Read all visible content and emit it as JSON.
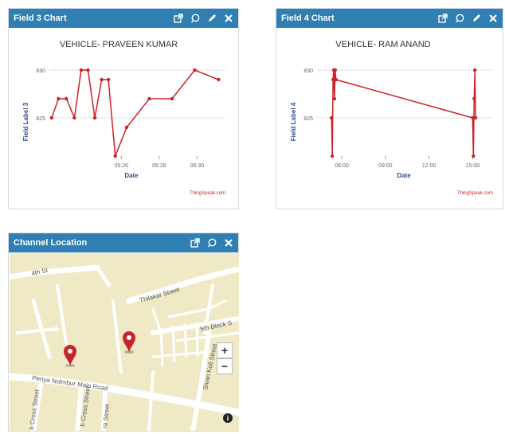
{
  "widgets": {
    "field3": {
      "title": "Field 3 Chart",
      "credit": "ThingSpeak.com"
    },
    "field4": {
      "title": "Field 4 Chart",
      "credit": "ThingSpeak.com"
    },
    "location": {
      "title": "Channel Location"
    }
  },
  "header_icons": [
    "external-link-icon",
    "comment-icon",
    "pencil-icon",
    "close-icon"
  ],
  "colors": {
    "header": "#2f7fb2",
    "series": "#cc2229",
    "axis_label": "#2c4f8a",
    "map_bg": "#efe9c5",
    "road": "#ffffff",
    "pin": "#c8242b"
  },
  "map": {
    "streets": [
      "4th St",
      "Thilakar Street",
      "5th Block S",
      "Periya Nolmbur Main Road",
      "Sivan Koil Street",
      "h Cross Street",
      "h Cross Street",
      "ra Street"
    ],
    "zoom_in": "+",
    "zoom_out": "−",
    "info": "i"
  },
  "chart_data": [
    {
      "type": "line",
      "title": "VEHICLE- PRAVEEN KUMAR",
      "xlabel": "Date",
      "ylabel": "Field Label 3",
      "ylim": [
        821,
        831
      ],
      "yticks": [
        825,
        830
      ],
      "xlim": [
        5.37,
        5.525
      ],
      "xticks": [
        {
          "v": 5.4333,
          "label": "05:26"
        },
        {
          "v": 5.4667,
          "label": "05:28"
        },
        {
          "v": 5.5,
          "label": "05:30"
        }
      ],
      "grid": true,
      "series": [
        {
          "x": [
            5.372,
            5.378,
            5.385,
            5.392,
            5.398,
            5.404,
            5.41,
            5.416,
            5.422,
            5.428,
            5.438,
            5.458,
            5.478,
            5.498,
            5.519
          ],
          "y": [
            825,
            827,
            827,
            825,
            830,
            830,
            825,
            829,
            829,
            821,
            824,
            827,
            827,
            830,
            829
          ]
        }
      ]
    },
    {
      "type": "line",
      "title": "VEHICLE- RAM ANAND",
      "xlabel": "Date",
      "ylabel": "Field Label 4",
      "ylim": [
        821,
        831
      ],
      "yticks": [
        825,
        830
      ],
      "xlim": [
        4.3,
        16.4
      ],
      "xticks": [
        {
          "v": 6,
          "label": "06:00"
        },
        {
          "v": 9,
          "label": "09:00"
        },
        {
          "v": 12,
          "label": "12:00"
        },
        {
          "v": 15,
          "label": "15:00"
        }
      ],
      "grid": true,
      "series": [
        {
          "x": [
            5.3,
            5.35,
            5.4,
            5.45,
            5.5,
            5.55,
            5.6,
            15.0,
            15.05,
            15.1,
            15.15,
            15.2
          ],
          "y": [
            825,
            821,
            829,
            830,
            827,
            830,
            829,
            825,
            821,
            827,
            830,
            825
          ]
        }
      ]
    }
  ]
}
